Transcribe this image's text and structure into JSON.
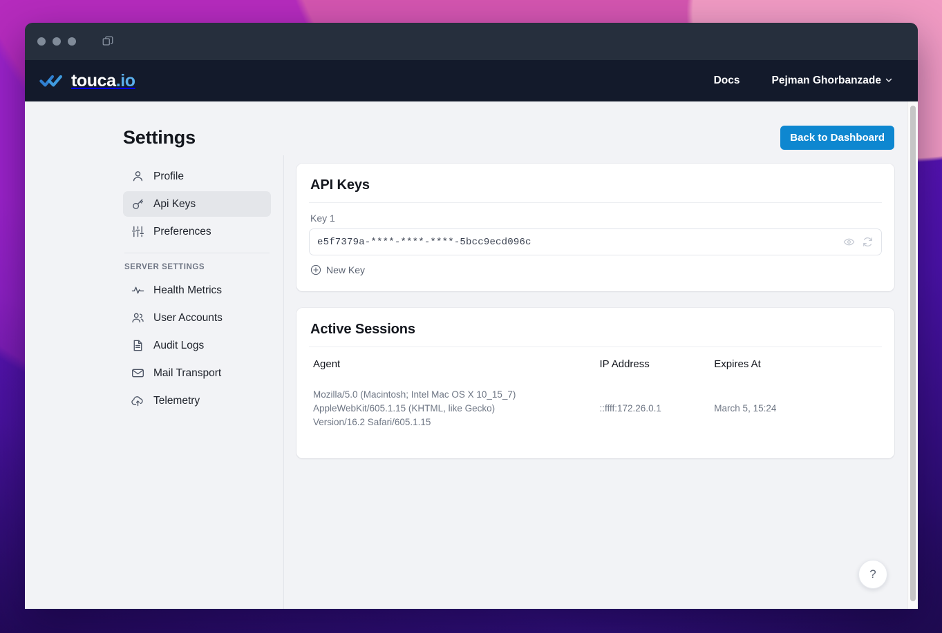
{
  "window": {
    "traffic_lights": [
      "close",
      "minimize",
      "maximize"
    ],
    "tabs_icon": "tabs-icon"
  },
  "navbar": {
    "logo_text_primary": "touca",
    "logo_text_suffix": ".io",
    "docs_label": "Docs",
    "user_name": "Pejman Ghorbanzade",
    "chevron": "⌄"
  },
  "header": {
    "title": "Settings",
    "back_button": "Back to Dashboard"
  },
  "sidebar": {
    "items": [
      {
        "label": "Profile",
        "icon": "user-icon",
        "active": false
      },
      {
        "label": "Api Keys",
        "icon": "key-icon",
        "active": true
      },
      {
        "label": "Preferences",
        "icon": "sliders-icon",
        "active": false
      }
    ],
    "section_label": "SERVER SETTINGS",
    "server_items": [
      {
        "label": "Health Metrics",
        "icon": "activity-icon"
      },
      {
        "label": "User Accounts",
        "icon": "users-icon"
      },
      {
        "label": "Audit Logs",
        "icon": "document-icon"
      },
      {
        "label": "Mail Transport",
        "icon": "envelope-icon"
      },
      {
        "label": "Telemetry",
        "icon": "cloud-upload-icon"
      }
    ]
  },
  "api_keys": {
    "title": "API Keys",
    "key_label": "Key 1",
    "key_value": "e5f7379a-****-****-****-5bcc9ecd096c",
    "reveal_icon": "eye-icon",
    "regenerate_icon": "refresh-icon",
    "new_key_label": "New Key",
    "new_key_icon": "plus-circle-icon"
  },
  "active_sessions": {
    "title": "Active Sessions",
    "columns": [
      "Agent",
      "IP Address",
      "Expires At"
    ],
    "rows": [
      {
        "agent_line1": "Mozilla/5.0 (Macintosh; Intel Mac OS X 10_15_7)",
        "agent_line2": "AppleWebKit/605.1.15 (KHTML, like Gecko)",
        "agent_line3": "Version/16.2 Safari/605.1.15",
        "ip_address": "::ffff:172.26.0.1",
        "expires_at": "March 5, 15:24"
      }
    ]
  },
  "help": {
    "label": "?"
  },
  "colors": {
    "accent_blue": "#0e87d0",
    "navbar_bg": "#131a2b",
    "titlebar_bg": "#262f3d",
    "page_bg": "#f2f3f6",
    "logo_blue": "#5aaeea"
  }
}
